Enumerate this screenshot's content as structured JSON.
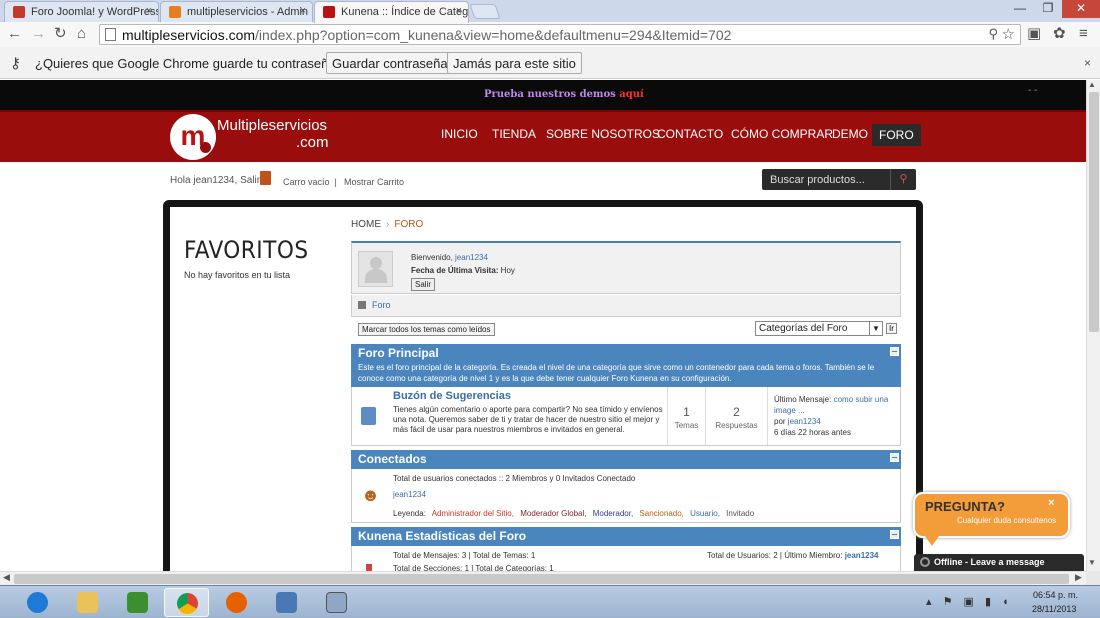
{
  "browser": {
    "tabs": [
      {
        "title": "Foro Joomla! y WordPress",
        "close": "×"
      },
      {
        "title": "multipleservicios - Admin",
        "close": "×"
      },
      {
        "title": "Kunena :: Índice de Categ",
        "close": "×"
      }
    ],
    "url_host": "multipleservicios.com",
    "url_path": "/index.php?option=com_kunena&view=home&defaultmenu=294&Itemid=702",
    "window_buttons": {
      "minimize": "—",
      "restore": "❐",
      "close": "✕"
    },
    "infobar": {
      "message": "¿Quieres que Google Chrome guarde tu contraseña?",
      "save_label": "Guardar contraseña",
      "never_label": "Jamás para este sitio",
      "close": "×"
    }
  },
  "site": {
    "promo_text": "Prueba nuestros demos ",
    "promo_link": "aquí",
    "top_dashes": "- -",
    "logo_line1": "Multipleservicios",
    "logo_line2": ".com",
    "logo_letter": "m",
    "menu": [
      "INICIO",
      "TIENDA",
      "SOBRE NOSOTROS",
      "CONTACTO",
      "CÓMO COMPRAR",
      "DEMO",
      "FORO"
    ],
    "user": {
      "greeting": "Hola jean1234,",
      "logout": "Salir",
      "cart_empty": "Carro vacío",
      "separator": "|",
      "show_cart": "Mostrar Carrito"
    },
    "search_placeholder": "Buscar productos...",
    "favorites": {
      "title": "FAVORITOS",
      "empty": "No hay favoritos en tu lista"
    },
    "breadcrumb": {
      "home": "HOME",
      "sep": "›",
      "current": "FORO"
    }
  },
  "kunena": {
    "welcome_prefix": "Bienvenido, ",
    "username": "jean1234",
    "last_visit_label": "Fecha de Última Visita:",
    "last_visit_value": " Hoy",
    "logout_button": "Salir",
    "forum_link": "Foro",
    "mark_all": "Marcar todos los temas como leídos",
    "category_select": "Categorías del Foro",
    "go_button": "Ir",
    "main_forum": {
      "title": "Foro Principal",
      "description": "Este es el foro principal de la categoría. Es creada el nivel de una categoría que sirve como un contenedor para cada tema o foros. También se le conoce como una categoría de nivel 1 y es la que debe tener cualquier Foro Kunena en su configuración."
    },
    "subforum": {
      "name": "Buzón de Sugerencias",
      "description": "Tienes algún comentario o aporte para compartir? No sea tímido y envíenos una nota. Queremos saber de ti y tratar de hacer de nuestro sitio el mejor y más fácil de usar para nuestros miembros e invitados en general.",
      "topics_count": "1",
      "topics_label": "Temas",
      "replies_count": "2",
      "replies_label": "Respuestas",
      "last_msg_label": "Último Mensaje: ",
      "last_msg_link": "como subir una image ...",
      "by_label": "por ",
      "by_user": "jean1234",
      "time_ago": "6 días 22 horas antes"
    },
    "online": {
      "title": "Conectados",
      "total": "Total de usuarios conectados :: 2 Miembros y 0 Invitados Conectado",
      "user": "jean1234",
      "legend_label": "Leyenda:",
      "legend": [
        {
          "label": "Administrador del Sitio,",
          "color": "#c0392b"
        },
        {
          "label": "Moderador Global,",
          "color": "#7a2a2a"
        },
        {
          "label": "Moderador,",
          "color": "#2c3e9e"
        },
        {
          "label": "Sancionado,",
          "color": "#b5651d"
        },
        {
          "label": "Usuario,",
          "color": "#3a6ea5"
        },
        {
          "label": "Invitado",
          "color": "#555555"
        }
      ]
    },
    "stats": {
      "title": "Kunena Estadísticas del Foro",
      "line1": "Total de Mensajes: 3  |  Total de Temas: 1",
      "line2": "Total de Secciones: 1  |  Total de Categorías: 1",
      "right_prefix": "Total de Usuarios: 2  |  Último Miembro: ",
      "latest_member": "jean1234"
    }
  },
  "chat": {
    "title": "PREGUNTA?",
    "subtitle": "Cualquier duda consultenos",
    "close": "×",
    "offline": "Offline - Leave a message"
  },
  "taskbar": {
    "apps": [
      "internet-explorer",
      "file-explorer",
      "webmatrix",
      "chrome",
      "firefox",
      "remote-desktop",
      "calculator"
    ],
    "time": "06:54 p. m.",
    "date": "28/11/2013",
    "tray_icons": "▴ ⚑ ▣ ▮ ◖"
  }
}
